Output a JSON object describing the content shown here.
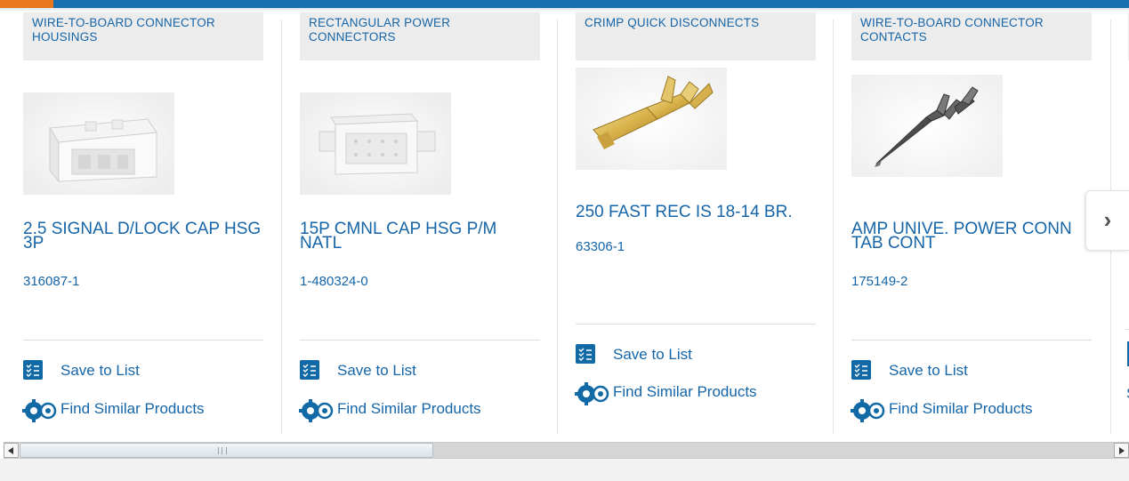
{
  "carousel": {
    "cards": [
      {
        "category": "WIRE-TO-BOARD CONNECTOR HOUSINGS",
        "title": "2.5 SIGNAL D/LOCK CAP HSG 3P",
        "part_number": "316087-1",
        "save_label": "Save to List",
        "similar_label": "Find Similar Products"
      },
      {
        "category": "RECTANGULAR POWER CONNECTORS",
        "title": "15P CMNL CAP HSG P/M NATL",
        "part_number": "1-480324-0",
        "save_label": "Save to List",
        "similar_label": "Find Similar Products"
      },
      {
        "category": "CRIMP QUICK DISCONNECTS",
        "title": "250 FAST REC IS 18-14 BR.",
        "part_number": "63306-1",
        "save_label": "Save to List",
        "similar_label": "Find Similar Products"
      },
      {
        "category": "WIRE-TO-BOARD CONNECTOR CONTACTS",
        "title": "AMP UNIVE. POWER CONN TAB CONT",
        "part_number": "175149-2",
        "save_label": "Save to List",
        "similar_label": "Find Similar Products"
      }
    ],
    "next_icon": "chevron-right-icon",
    "partial_card_text": "S"
  },
  "colors": {
    "brand_blue": "#1565a8",
    "icon_blue": "#1169a6",
    "accent_orange": "#e8771e",
    "category_bg": "#ececec"
  }
}
